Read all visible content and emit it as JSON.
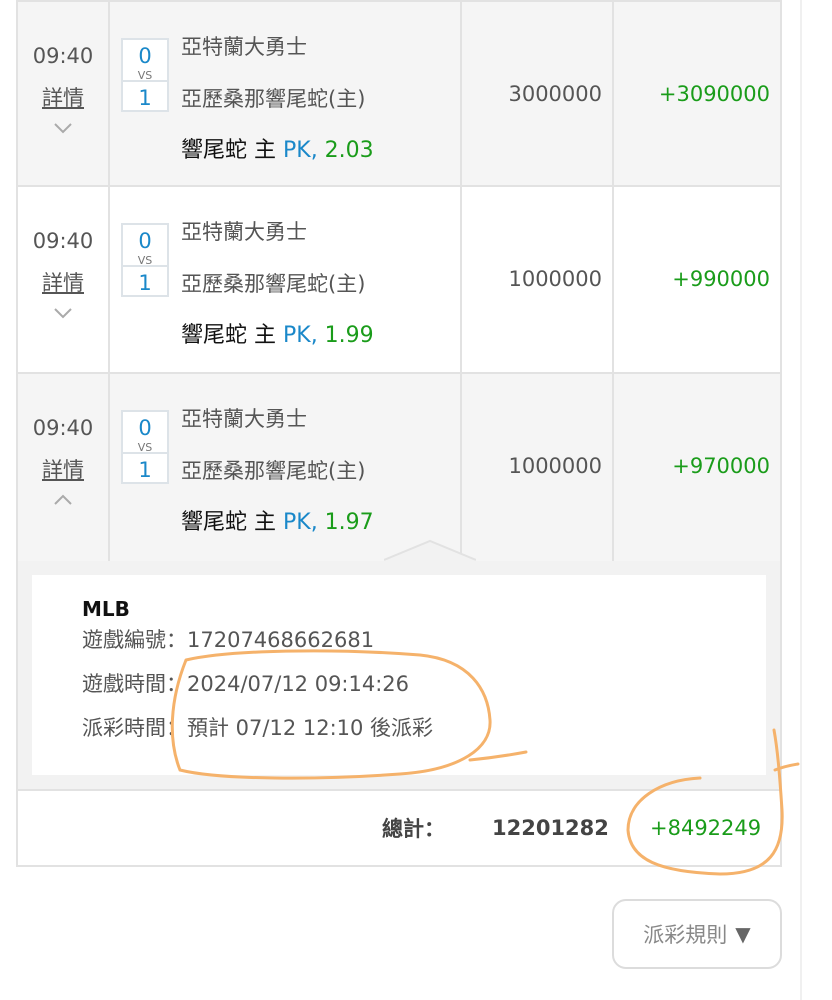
{
  "bets": [
    {
      "time": "09:40",
      "detail_label": "詳情",
      "chevron": "chevron-down-icon",
      "score_home": "0",
      "vs": "VS",
      "score_away": "1",
      "team1": "亞特蘭大勇士",
      "team2": "亞歷桑那響尾蛇(主)",
      "pick_prefix": "響尾蛇 主 ",
      "pick_market": "PK,",
      "pick_odds": " 2.03",
      "stake": "3000000",
      "win": "+3090000"
    },
    {
      "time": "09:40",
      "detail_label": "詳情",
      "chevron": "chevron-down-icon",
      "score_home": "0",
      "vs": "VS",
      "score_away": "1",
      "team1": "亞特蘭大勇士",
      "team2": "亞歷桑那響尾蛇(主)",
      "pick_prefix": "響尾蛇 主 ",
      "pick_market": "PK,",
      "pick_odds": " 1.99",
      "stake": "1000000",
      "win": "+990000"
    },
    {
      "time": "09:40",
      "detail_label": "詳情",
      "chevron": "chevron-up-icon",
      "score_home": "0",
      "vs": "VS",
      "score_away": "1",
      "team1": "亞特蘭大勇士",
      "team2": "亞歷桑那響尾蛇(主)",
      "pick_prefix": "響尾蛇 主 ",
      "pick_market": "PK,",
      "pick_odds": " 1.97",
      "stake": "1000000",
      "win": "+970000"
    }
  ],
  "detail": {
    "league": "MLB",
    "game_no": "遊戲編號：17207468662681",
    "game_time": "遊戲時間：2024/07/12 09:14:26",
    "payout_time": "派彩時間：預計 07/12 12:10 後派彩"
  },
  "total": {
    "label": "總計：",
    "stake": "12201282",
    "win": "+8492249"
  },
  "rules_button": {
    "label": "派彩規則",
    "icon": "triangle-down-icon",
    "glyph": "▼"
  },
  "colors": {
    "win_green": "#1a9c1a",
    "link_blue": "#1a88c9",
    "annotation_orange": "#f5b26b"
  }
}
